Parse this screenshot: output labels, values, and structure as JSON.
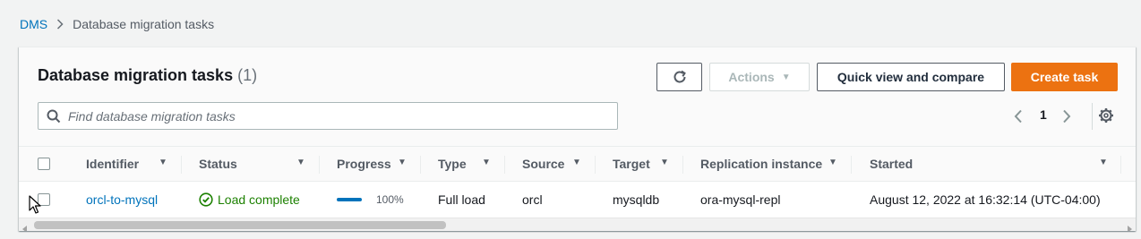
{
  "breadcrumb": {
    "root": "DMS",
    "current": "Database migration tasks"
  },
  "header": {
    "title": "Database migration tasks",
    "count": "(1)",
    "actions_label": "Actions",
    "quick_view_label": "Quick view and compare",
    "create_label": "Create task"
  },
  "search": {
    "placeholder": "Find database migration tasks",
    "value": ""
  },
  "pagination": {
    "current_page": "1"
  },
  "table": {
    "columns": [
      "Identifier",
      "Status",
      "Progress",
      "Type",
      "Source",
      "Target",
      "Replication instance",
      "Started"
    ],
    "rows": [
      {
        "identifier": "orcl-to-mysql",
        "status": "Load complete",
        "progress": "100%",
        "progress_fraction": 1.0,
        "type": "Full load",
        "source": "orcl",
        "target": "mysqldb",
        "replication_instance": "ora-mysql-repl",
        "started": "August 12, 2022 at 16:32:14 (UTC-04:00)"
      }
    ]
  },
  "icons": {
    "refresh": "refresh-icon",
    "search": "search-icon",
    "settings": "gear-icon",
    "status": "check-circle-icon"
  },
  "colors": {
    "primary_button": "#ec7211",
    "link": "#0073bb",
    "success": "#1d8102"
  }
}
